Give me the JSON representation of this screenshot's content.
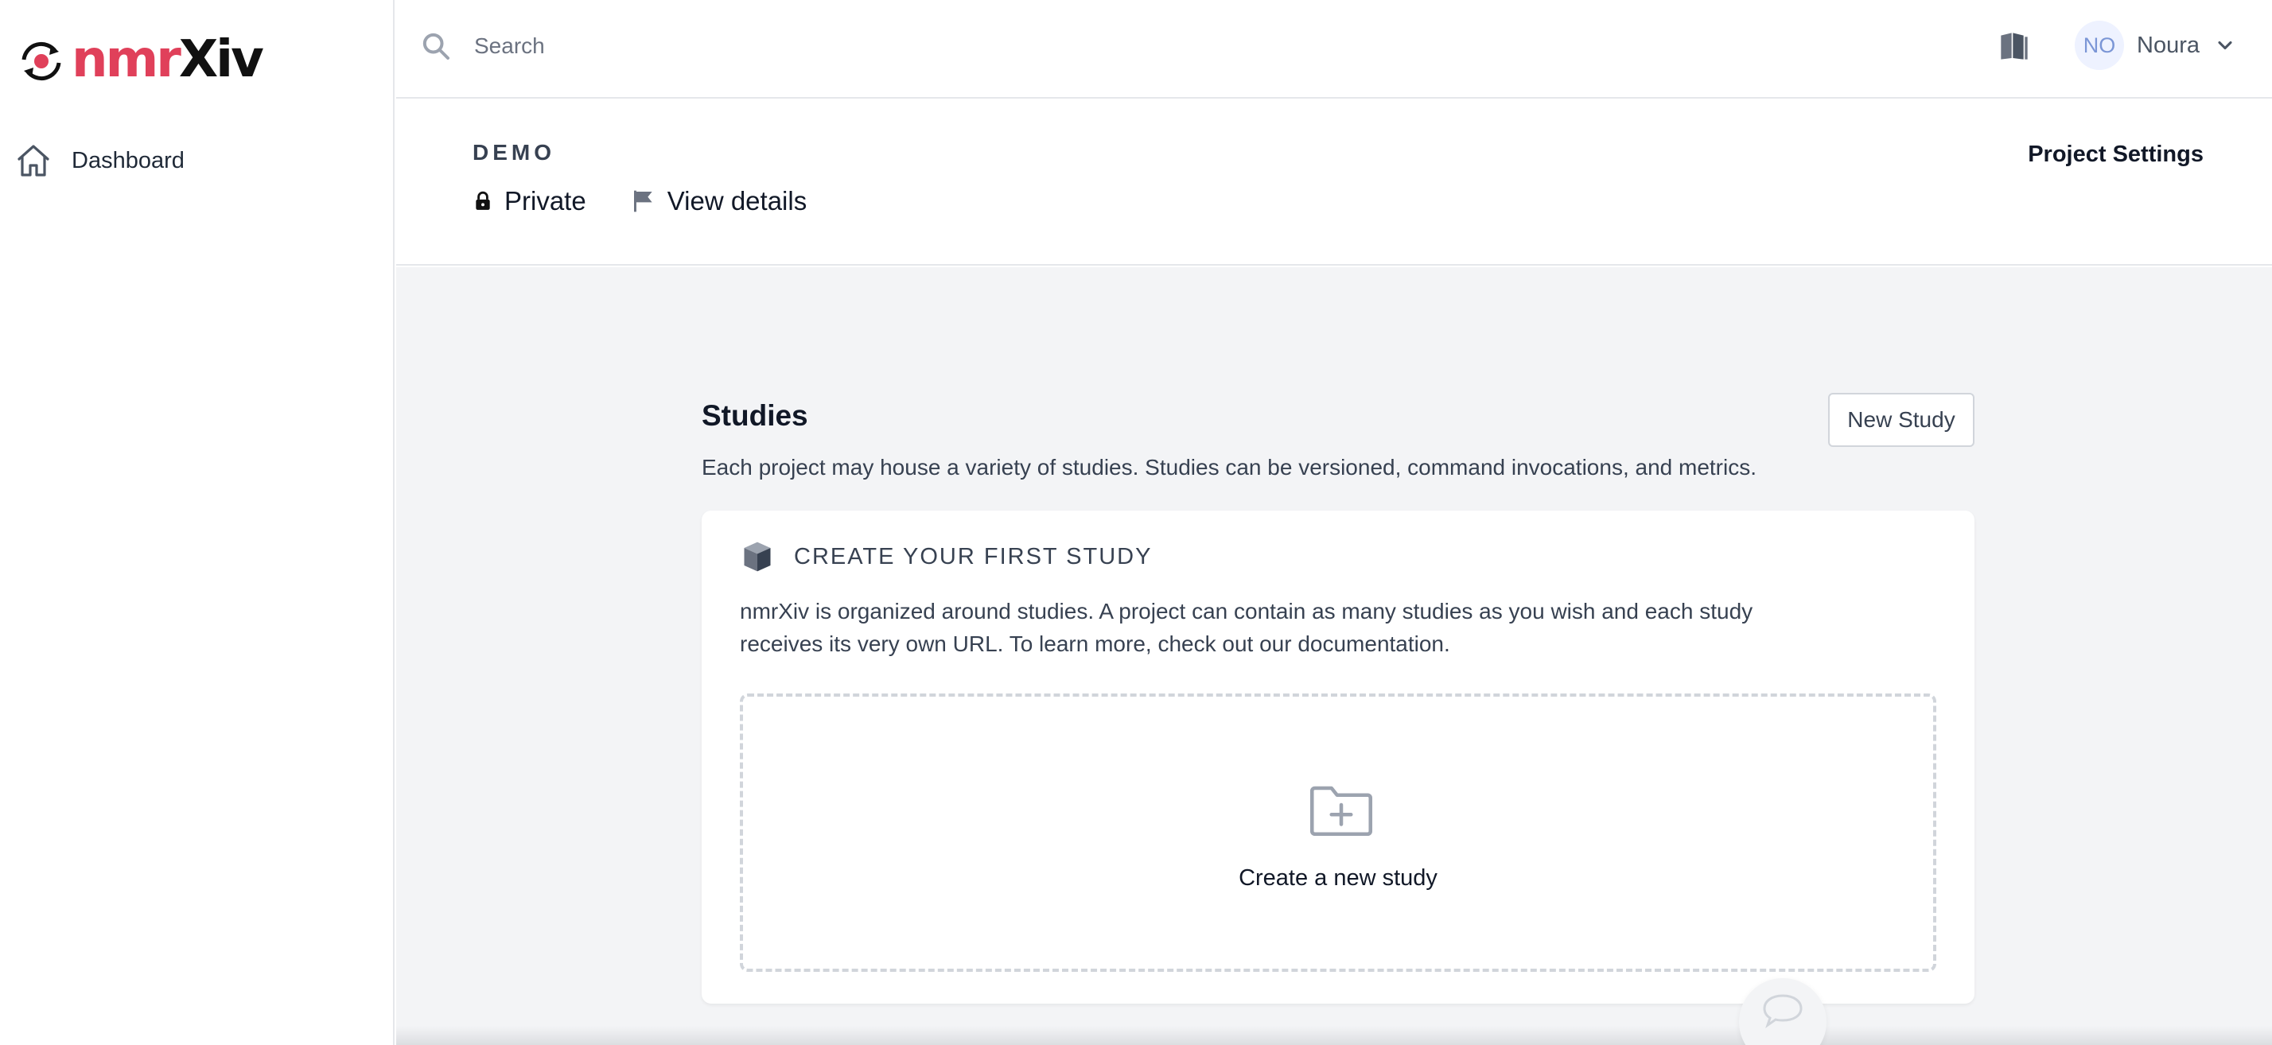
{
  "app": {
    "logo_part1": "nmr",
    "logo_part2": "Xiv",
    "brand_color": "#e0405a"
  },
  "sidebar": {
    "items": [
      {
        "label": "Dashboard",
        "icon": "home-icon"
      }
    ]
  },
  "topbar": {
    "search_placeholder": "Search",
    "avatar_initials": "NO",
    "user_name": "Noura",
    "icons": [
      "search-icon",
      "book-icon",
      "chevron-down-icon"
    ]
  },
  "project": {
    "name": "DEMO",
    "visibility": "Private",
    "view_details": "View details",
    "settings": "Project Settings"
  },
  "studies": {
    "title": "Studies",
    "new_button": "New Study",
    "description": "Each project may house a variety of studies. Studies can be versioned, command invocations, and metrics.",
    "empty_state": {
      "title": "CREATE YOUR FIRST STUDY",
      "body": "nmrXiv is organized around studies. A project can contain as many studies as you wish and each study receives its very own URL. To learn more, check out our documentation.",
      "create_label": "Create a new study"
    }
  }
}
